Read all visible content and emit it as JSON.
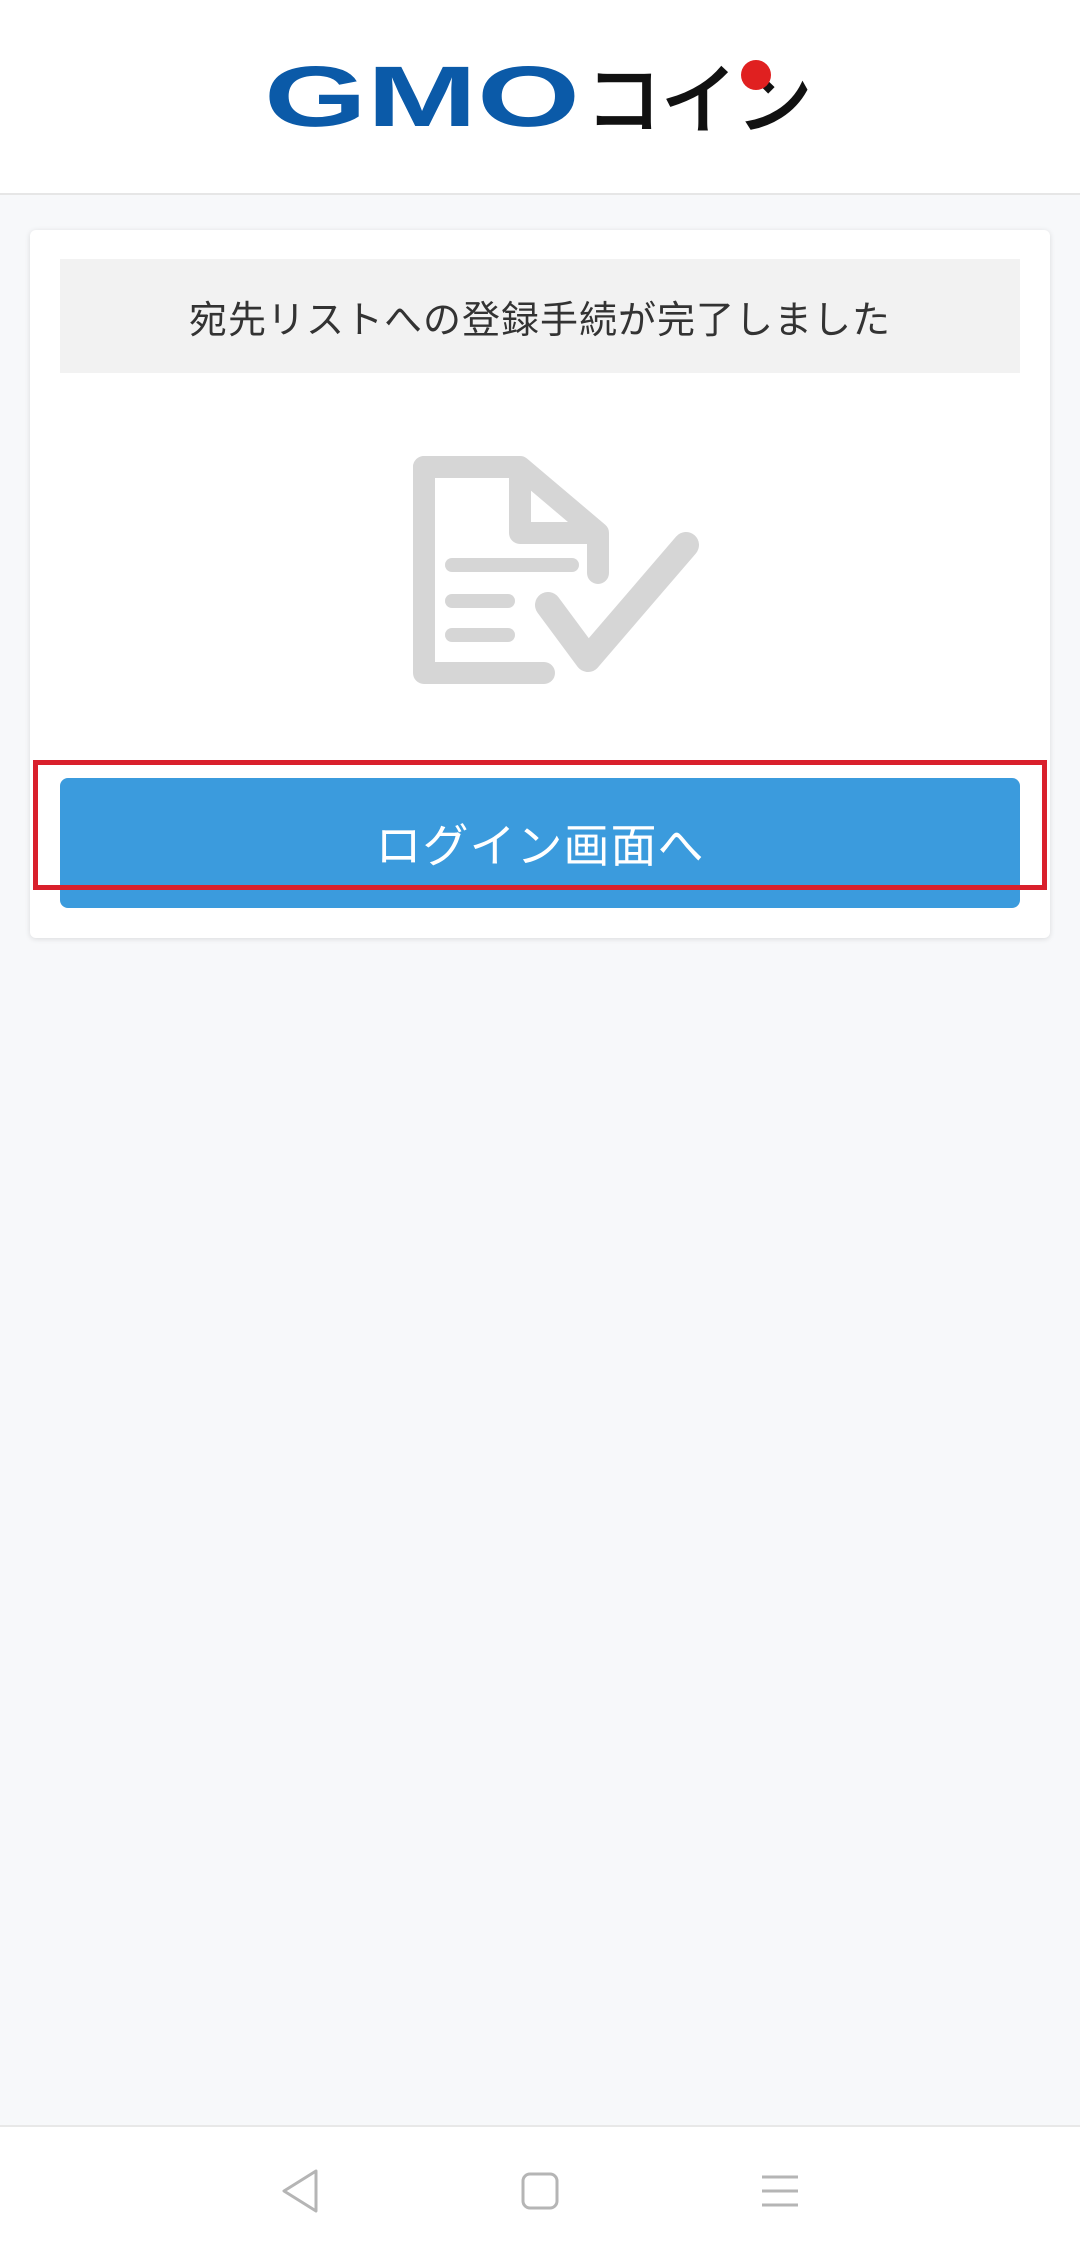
{
  "header": {
    "logo_text_gmo": "GMO",
    "logo_text_coin": "コイン",
    "brand_blue": "#0b5aa8",
    "brand_red": "#e02020"
  },
  "card": {
    "message": "宛先リストへの登録手続が完了しました",
    "icon": "document-check-icon",
    "login_button_label": "ログイン画面へ",
    "button_color": "#3b9bdd",
    "highlight_color": "#d9202c"
  },
  "nav": {
    "back_icon": "back-triangle-icon",
    "home_icon": "home-square-icon",
    "menu_icon": "menu-lines-icon"
  }
}
